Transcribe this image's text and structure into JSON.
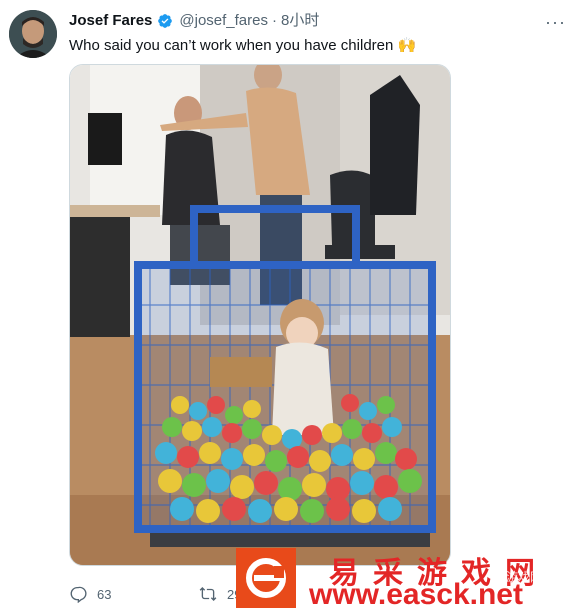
{
  "tweet": {
    "author_name": "Josef Fares",
    "handle": "@josef_fares",
    "separator": "·",
    "time": "8小时",
    "text": "Who said you can’t work when you have children 🙌",
    "more_label": "···",
    "reply_count": "63",
    "retweet_count": "29"
  },
  "watermark": {
    "site_name": "易采游戏网",
    "site_url": "www.easck.net",
    "small_text": "游戏网"
  },
  "colors": {
    "verified": "#1d9bf0",
    "text_primary": "#0f1419",
    "text_secondary": "#536471",
    "watermark_red": "#e32626"
  },
  "icons": [
    "verified-badge-icon",
    "more-icon",
    "reply-icon",
    "retweet-icon",
    "watermark-logo-icon"
  ]
}
